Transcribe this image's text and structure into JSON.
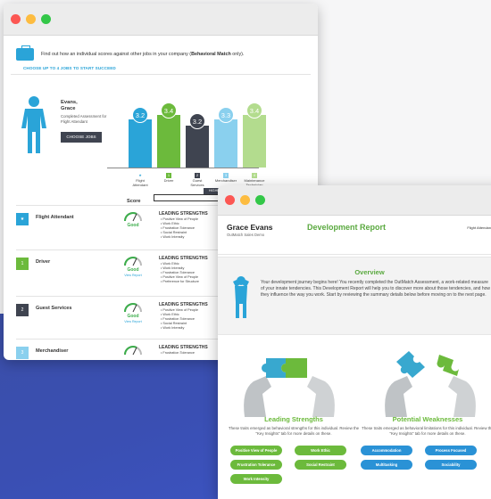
{
  "window1": {
    "intro_text": "Find out how an individual scores against other jobs in your company (",
    "intro_bold": "Behavioral Match",
    "intro_tail": " only).",
    "choose_label": "CHOOSE UP TO 4 JOBS TO START SUCCEED",
    "candidate": {
      "last_first": "Evans,",
      "first": "Grace",
      "sub": "Completed Assessment for Flight Attendant"
    },
    "choose_jobs_button": "CHOOSE JOBS",
    "bars": [
      {
        "label": "3.2",
        "value": 3.2,
        "color": "#2aa4d8",
        "bubble": "#2aa4d8",
        "category": "Flight Attendant",
        "chip": "★",
        "chip_color": "#2aa4d8",
        "height_level": 0.75
      },
      {
        "label": "3.4",
        "value": 3.4,
        "color": "#6cba3c",
        "bubble": "#6cba3c",
        "category": "Driver",
        "chip": "1",
        "chip_color": "#6cba3c",
        "height_level": 0.82
      },
      {
        "label": "3.2",
        "value": 3.2,
        "color": "#3f4450",
        "bubble": "#3f4450",
        "category": "Guest Services",
        "chip": "2",
        "chip_color": "#3f4450",
        "height_level": 0.65
      },
      {
        "label": "3.3",
        "value": 3.3,
        "color": "#8ad0ee",
        "bubble": "#8ad0ee",
        "category": "Merchandiser",
        "chip": "3",
        "chip_color": "#8ad0ee",
        "height_level": 0.75
      },
      {
        "label": "3.4",
        "value": 3.4,
        "color": "#b3dc8e",
        "bubble": "#b3dc8e",
        "category": "Maintenance Technician",
        "chip": "4",
        "chip_color": "#b3dc8e",
        "height_level": 0.82
      }
    ],
    "score_header": "Score",
    "highlight_tag": "HIGHLIGH",
    "jobs": [
      {
        "num": "★",
        "color": "#2aa4d8",
        "name": "Flight Attendant",
        "rating": "Good",
        "view": "",
        "strengths_title": "LEADING STRENGTHS",
        "strengths": [
          "Positive View of People",
          "Work Ethic",
          "Frustration Tolerance",
          "Social Restraint",
          "Work Intensity"
        ]
      },
      {
        "num": "1",
        "color": "#6cba3c",
        "name": "Driver",
        "rating": "Good",
        "view": "View Report",
        "strengths_title": "LEADING STRENGTHS",
        "strengths": [
          "Work Ethic",
          "Work Intensity",
          "Frustration Tolerance",
          "Positive View of People",
          "Preference for Structure"
        ]
      },
      {
        "num": "2",
        "color": "#3f4450",
        "name": "Guest Services",
        "rating": "Good",
        "view": "View Report",
        "strengths_title": "LEADING STRENGTHS",
        "strengths": [
          "Positive View of People",
          "Work Ethic",
          "Frustration Tolerance",
          "Social Restraint",
          "Work Intensity"
        ]
      },
      {
        "num": "3",
        "color": "#8ad0ee",
        "name": "Merchandiser",
        "rating": "",
        "view": "",
        "strengths_title": "LEADING STRENGTHS",
        "strengths": [
          "Frustration Tolerance"
        ]
      }
    ]
  },
  "window2": {
    "name": "Grace Evans",
    "company": "OutMatch Sales Demo",
    "title": "Development Report",
    "right_label": "Flight Attendan",
    "overview_title": "Overview",
    "overview_text": "Your development journey begins here! You recently completed the OutMatch Assessment, a work-related measure of your innate tendencies. This Development Report will help you to discover more about those tendencies, and how they influence the way you work. Start by reviewing the summary details below before moving on to the next page.",
    "strengths_title": "Leading Strengths",
    "strengths_desc": "These traits emerged as behavioral strengths for this individual. Review the \"Key Insights\" tab for more details on these.",
    "weak_title": "Potential Weaknesses",
    "weak_desc": "These traits emerged as behavioral limitations for this individual. Review the \"Key Insights\" tab for more details on these.",
    "strength_pills": [
      "Positive View of People",
      "Work Ethic",
      "Frustration Tolerance",
      "Social Restraint",
      "Work Intensity"
    ],
    "weak_pills": [
      "Accommodation",
      "Process Focused",
      "Multitasking",
      "Sociability"
    ],
    "colors": {
      "green": "#6cba3c",
      "blue": "#2a92d6",
      "title_green": "#5aa93f"
    }
  }
}
